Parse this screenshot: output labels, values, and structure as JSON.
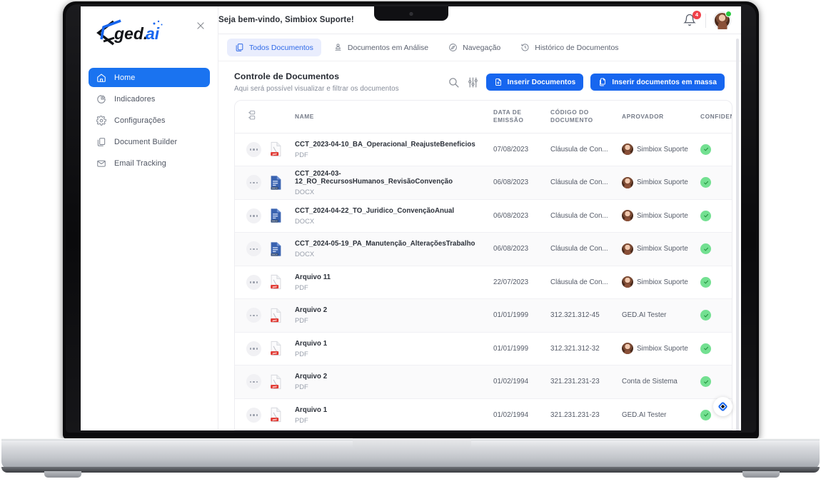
{
  "device": {
    "kind": "laptop-mockup"
  },
  "sidebar": {
    "logo_text": "ged.ai",
    "close_label": "×",
    "items": [
      {
        "label": "Home",
        "icon": "home-icon",
        "active": true
      },
      {
        "label": "Indicadores",
        "icon": "pie-chart-icon",
        "active": false
      },
      {
        "label": "Configurações",
        "icon": "gear-icon",
        "active": false
      },
      {
        "label": "Document Builder",
        "icon": "documents-icon",
        "active": false
      },
      {
        "label": "Email Tracking",
        "icon": "mail-icon",
        "active": false
      }
    ]
  },
  "topbar": {
    "welcome": "Seja bem-vindo, Simbiox Suporte!",
    "notification_count": "4",
    "bell_icon": "bell-icon",
    "avatar_icon": "user-avatar"
  },
  "tabs": [
    {
      "label": "Todos Documentos",
      "icon": "documents-copy-icon",
      "active": true
    },
    {
      "label": "Documentos em Análise",
      "icon": "stamp-person-icon",
      "active": false
    },
    {
      "label": "Navegação",
      "icon": "compass-icon",
      "active": false
    },
    {
      "label": "Histórico de Documentos",
      "icon": "history-clock-icon",
      "active": false
    }
  ],
  "page": {
    "title": "Controle de Documentos",
    "subtitle": "Aqui será possível visualizar e filtrar os documentos",
    "search_icon": "search-icon",
    "filter_icon": "sliders-filter-icon",
    "btn_insert": "Inserir Documentos",
    "btn_insert_bulk": "Inserir documentos em massa"
  },
  "table": {
    "columns": [
      {
        "key": "menu",
        "label": ""
      },
      {
        "key": "file_icon",
        "label": ""
      },
      {
        "key": "name",
        "label": "NAME"
      },
      {
        "key": "date",
        "label": "DATA DE EMISSÃO"
      },
      {
        "key": "code",
        "label": "CÓDIGO DO DOCUMENTO"
      },
      {
        "key": "approver",
        "label": "APROVADOR"
      },
      {
        "key": "confidential",
        "label": "CONFIDENCIAL"
      }
    ],
    "rows": [
      {
        "name": "CCT_2023-04-10_BA_Operacional_ReajusteBeneficios",
        "type": "PDF",
        "date": "07/08/2023",
        "code": "Cláusula de Con...",
        "approver": "Simbiox Suporte",
        "has_avatar": true,
        "confidential": true
      },
      {
        "name": "CCT_2024-03-12_RO_RecursosHumanos_RevisãoConvenção",
        "type": "DOCX",
        "date": "06/08/2023",
        "code": "Cláusula de Con...",
        "approver": "Simbiox Suporte",
        "has_avatar": true,
        "confidential": true
      },
      {
        "name": "CCT_2024-04-22_TO_Juridico_ConvençãoAnual",
        "type": "DOCX",
        "date": "06/08/2023",
        "code": "Cláusula de Con...",
        "approver": "Simbiox Suporte",
        "has_avatar": true,
        "confidential": true
      },
      {
        "name": "CCT_2024-05-19_PA_Manutenção_AlteraçõesTrabalho",
        "type": "DOCX",
        "date": "06/08/2023",
        "code": "Cláusula de Con...",
        "approver": "Simbiox Suporte",
        "has_avatar": true,
        "confidential": true
      },
      {
        "name": "Arquivo 11",
        "type": "PDF",
        "date": "22/07/2023",
        "code": "Cláusula de Con...",
        "approver": "Simbiox Suporte",
        "has_avatar": true,
        "confidential": true
      },
      {
        "name": "Arquivo 2",
        "type": "PDF",
        "date": "01/01/1999",
        "code": "312.321.312-45",
        "approver": "GED.AI Tester",
        "has_avatar": false,
        "confidential": true
      },
      {
        "name": "Arquivo 1",
        "type": "PDF",
        "date": "01/01/1999",
        "code": "312.321.312-32",
        "approver": "Simbiox Suporte",
        "has_avatar": true,
        "confidential": true
      },
      {
        "name": "Arquivo 2",
        "type": "PDF",
        "date": "01/02/1994",
        "code": "321.231.231-23",
        "approver": "Conta de Sistema",
        "has_avatar": false,
        "confidential": true
      },
      {
        "name": "Arquivo 1",
        "type": "PDF",
        "date": "01/02/1994",
        "code": "321.231.231-23",
        "approver": "GED.AI Tester",
        "has_avatar": false,
        "confidential": true
      }
    ]
  },
  "fab": {
    "icon": "ged-diamond-logo-icon"
  },
  "colors": {
    "accent": "#1766ef",
    "tab_active_bg": "#e9edfd",
    "tab_active_text": "#2f6ae8",
    "badge_red": "#f0414a",
    "check_green": "#73e091",
    "online_green": "#27c93f",
    "pdf_red": "#e0322b",
    "docx_blue": "#3a63b0"
  }
}
